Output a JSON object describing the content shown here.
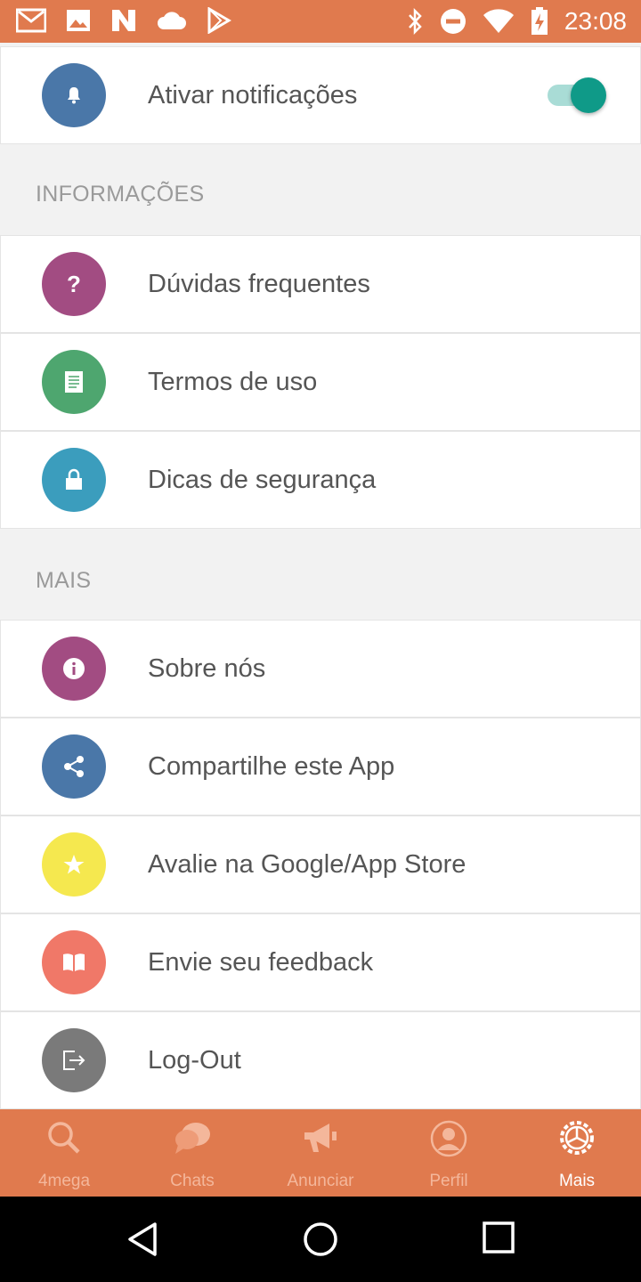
{
  "status_bar": {
    "time": "23:08",
    "left_icons": [
      "gmail-icon",
      "image-icon",
      "n-app-icon",
      "cloud-icon",
      "play-store-icon"
    ],
    "right_icons": [
      "bluetooth-icon",
      "do-not-disturb-icon",
      "wifi-icon",
      "battery-charging-icon"
    ]
  },
  "notifications": {
    "label": "Ativar notificações",
    "enabled": true,
    "icon": "bell-icon",
    "icon_color": "#4a77a8"
  },
  "sections": [
    {
      "title": "INFORMAÇÕES",
      "items": [
        {
          "label": "Dúvidas frequentes",
          "icon": "question-icon",
          "color": "#a24c82"
        },
        {
          "label": "Termos de uso",
          "icon": "document-icon",
          "color": "#4ea66f"
        },
        {
          "label": "Dicas de segurança",
          "icon": "lock-icon",
          "color": "#3b9dbd"
        }
      ]
    },
    {
      "title": "MAIS",
      "items": [
        {
          "label": "Sobre nós",
          "icon": "info-icon",
          "color": "#a24c82"
        },
        {
          "label": "Compartilhe este App",
          "icon": "share-icon",
          "color": "#4a77a8"
        },
        {
          "label": "Avalie na Google/App Store",
          "icon": "star-icon",
          "color": "#f5e84f"
        },
        {
          "label": "Envie seu feedback",
          "icon": "book-icon",
          "color": "#f07868"
        },
        {
          "label": "Log-Out",
          "icon": "logout-icon",
          "color": "#7a7a7a"
        }
      ]
    }
  ],
  "bottom_nav": {
    "items": [
      {
        "label": "4mega",
        "icon": "search-icon",
        "active": false
      },
      {
        "label": "Chats",
        "icon": "chat-icon",
        "active": false
      },
      {
        "label": "Anunciar",
        "icon": "megaphone-icon",
        "active": false
      },
      {
        "label": "Perfil",
        "icon": "profile-icon",
        "active": false
      },
      {
        "label": "Mais",
        "icon": "settings-icon",
        "active": true
      }
    ],
    "accent": "#e07a4e"
  }
}
